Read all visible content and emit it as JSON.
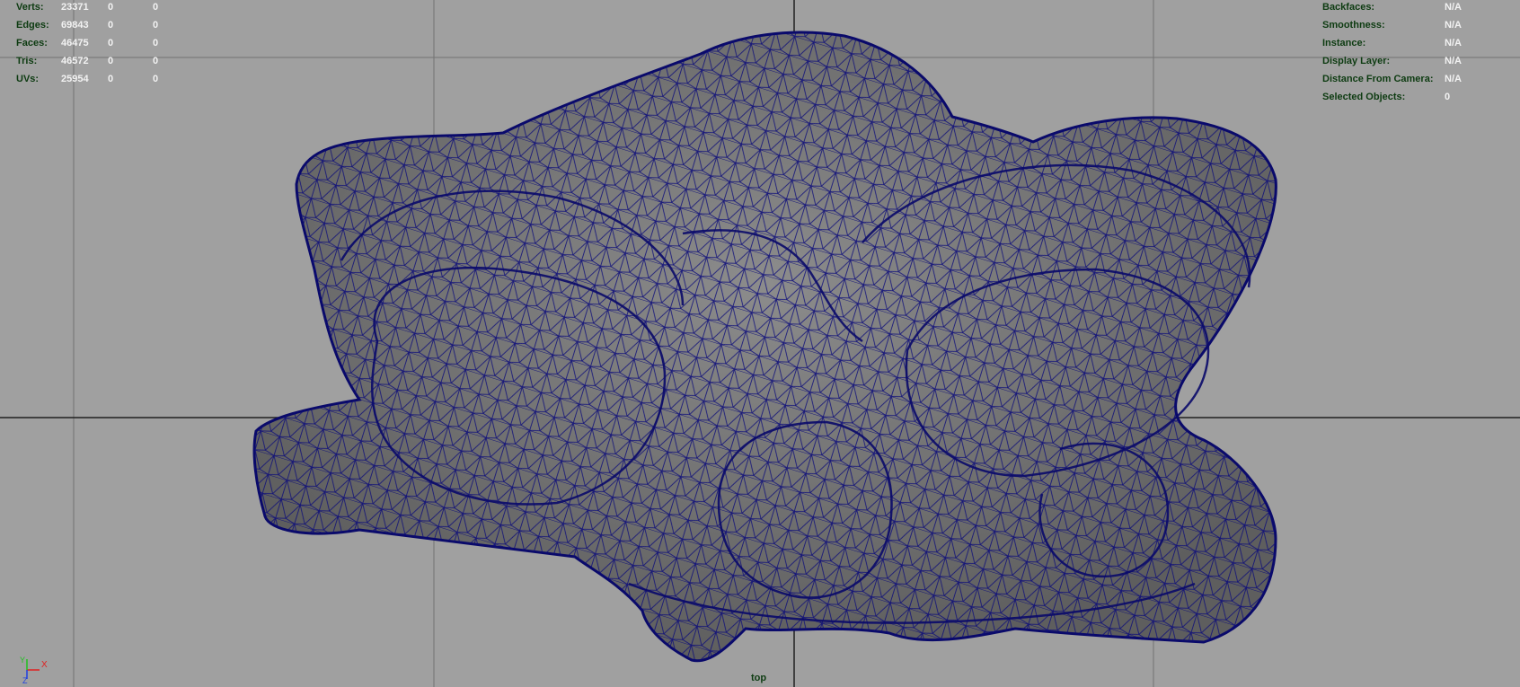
{
  "stats": {
    "rows": [
      {
        "label": "Verts:",
        "total": "23371",
        "selected": "0",
        "extra": "0"
      },
      {
        "label": "Edges:",
        "total": "69843",
        "selected": "0",
        "extra": "0"
      },
      {
        "label": "Faces:",
        "total": "46475",
        "selected": "0",
        "extra": "0"
      },
      {
        "label": "Tris:",
        "total": "46572",
        "selected": "0",
        "extra": "0"
      },
      {
        "label": "UVs:",
        "total": "25954",
        "selected": "0",
        "extra": "0"
      }
    ]
  },
  "info": {
    "rows": [
      {
        "label": "Backfaces:",
        "value": "N/A"
      },
      {
        "label": "Smoothness:",
        "value": "N/A"
      },
      {
        "label": "Instance:",
        "value": "N/A"
      },
      {
        "label": "Display Layer:",
        "value": "N/A"
      },
      {
        "label": "Distance From Camera:",
        "value": "N/A"
      },
      {
        "label": "Selected Objects:",
        "value": "0"
      }
    ]
  },
  "camera": {
    "name": "top"
  },
  "axis": {
    "x_label": "X",
    "y_label": "Y",
    "z_label": "Z",
    "x_color": "#e02020",
    "y_color": "#20c020",
    "z_color": "#2040e0"
  },
  "colors": {
    "background": "#a0a0a0",
    "wireframe": "#0a0a7a",
    "mesh_fill": "#747474",
    "grid": "#6e6e6e"
  }
}
